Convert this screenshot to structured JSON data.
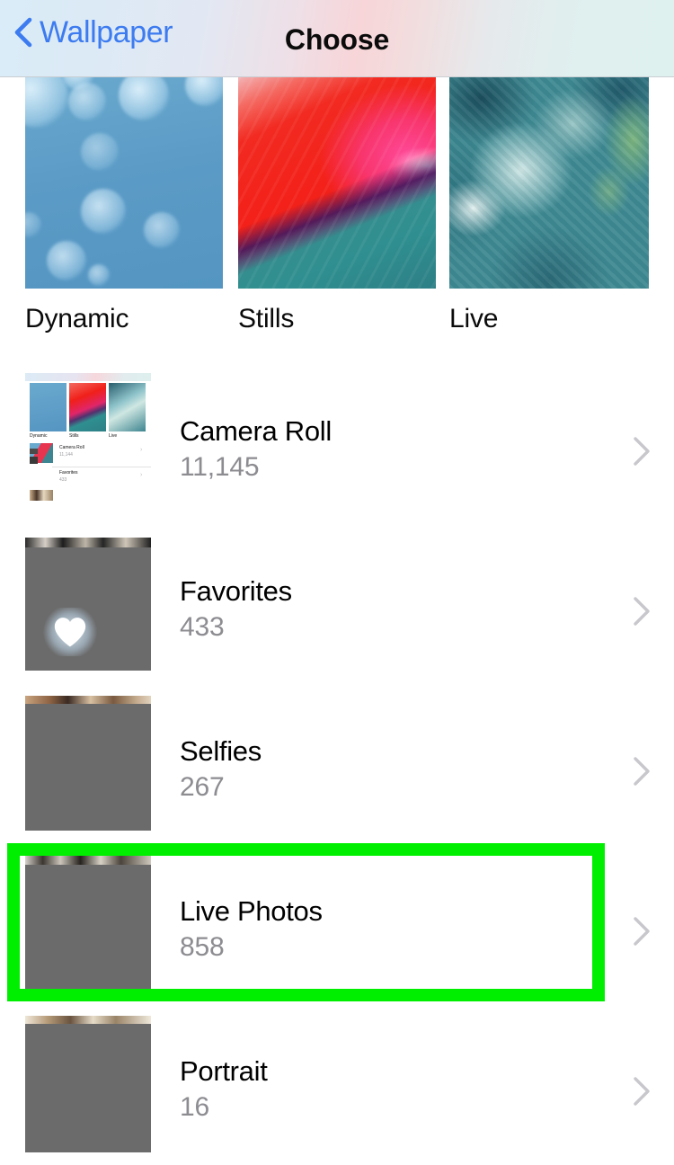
{
  "nav": {
    "back_label": "Wallpaper",
    "back_icon": "chevron-left-icon",
    "title": "Choose"
  },
  "categories": [
    {
      "label": "Dynamic",
      "art": "blue-bokeh"
    },
    {
      "label": "Stills",
      "art": "red-pink-teal-gradient"
    },
    {
      "label": "Live",
      "art": "teal-green-clouds"
    }
  ],
  "albums": [
    {
      "title": "Camera Roll",
      "count": "11,145",
      "thumb": "recursive-screenshot",
      "chevron": "chevron-right-icon",
      "highlighted": false
    },
    {
      "title": "Favorites",
      "count": "433",
      "thumb": "grey-redacted-heart",
      "chevron": "chevron-right-icon",
      "highlighted": false
    },
    {
      "title": "Selfies",
      "count": "267",
      "thumb": "grey-redacted",
      "chevron": "chevron-right-icon",
      "highlighted": false
    },
    {
      "title": "Live Photos",
      "count": "858",
      "thumb": "grey-redacted",
      "chevron": "chevron-right-icon",
      "highlighted": true
    },
    {
      "title": "Portrait",
      "count": "16",
      "thumb": "grey-redacted",
      "chevron": "chevron-right-icon",
      "highlighted": false
    }
  ],
  "mini_preview": {
    "tile_labels": [
      "Dynamic",
      "Stills",
      "Live"
    ],
    "rows": [
      {
        "title": "Camera Roll",
        "count": "11,144"
      },
      {
        "title": "Favorites",
        "count": "433"
      }
    ]
  },
  "colors": {
    "accent_blue": "#3d7bf0",
    "highlight_green": "#00ef00",
    "count_grey": "#8c8c91",
    "chevron_grey": "#c7c7cc",
    "title_black": "#000000"
  }
}
